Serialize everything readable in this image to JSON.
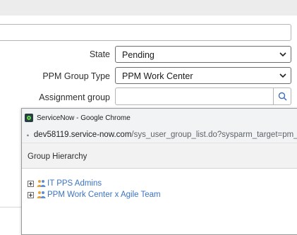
{
  "form": {
    "state": {
      "label": "State",
      "value": "Pending"
    },
    "ppm_group_type": {
      "label": "PPM Group Type",
      "value": "PPM Work Center"
    },
    "assignment_group": {
      "label": "Assignment group",
      "value": ""
    }
  },
  "popup": {
    "window_title": "ServiceNow - Google Chrome",
    "url_host": "dev58119.service-now.com",
    "url_path": "/sys_user_group_list.do?sysparm_target=pm_p",
    "section_title": "Group Hierarchy",
    "tree": [
      {
        "label": "IT PPS Admins"
      },
      {
        "label": "PPM Work Center x Agile Team"
      }
    ]
  },
  "colors": {
    "link": "#3b74c2",
    "chrome_bar": "#f1f3f4"
  },
  "icons": [
    "chevron-down-icon",
    "search-icon",
    "servicenow-logo-icon",
    "lock-icon",
    "expand-icon",
    "group-icon"
  ]
}
